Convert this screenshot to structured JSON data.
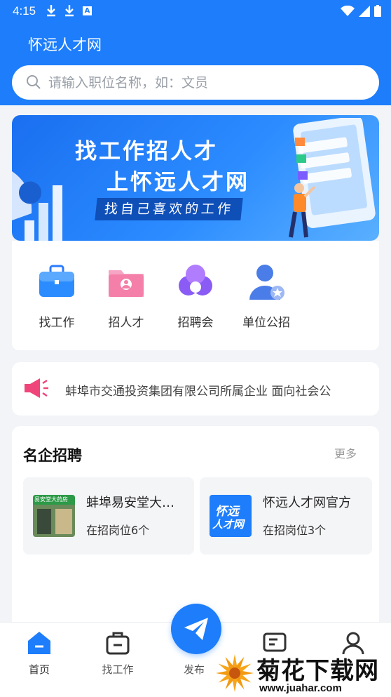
{
  "status_bar": {
    "time": "4:15",
    "keyboard_badge": "A"
  },
  "header": {
    "title": "怀远人才网"
  },
  "search": {
    "placeholder": "请输入职位名称，如：文员"
  },
  "banner": {
    "line1": "找工作招人才",
    "line2": "上怀远人才网",
    "tagline": "找自己喜欢的工作"
  },
  "quick_entries": [
    {
      "label": "找工作",
      "icon": "briefcase-icon"
    },
    {
      "label": "招人才",
      "icon": "user-folder-icon"
    },
    {
      "label": "招聘会",
      "icon": "group-meeting-icon"
    },
    {
      "label": "单位公招",
      "icon": "user-star-icon"
    }
  ],
  "notice": {
    "text": "蚌埠市交通投资集团有限公司所属企业 面向社会公",
    "icon": "megaphone-icon"
  },
  "famous": {
    "title": "名企招聘",
    "more": "更多",
    "companies": [
      {
        "name": "蚌埠易安堂大…",
        "count": "在招岗位6个",
        "logo_text": "易安堂大药房"
      },
      {
        "name": "怀远人才网官方",
        "count": "在招岗位3个",
        "logo_line1": "怀远",
        "logo_line2": "人才网"
      }
    ]
  },
  "bottom_nav": {
    "home": "首页",
    "jobs": "找工作",
    "publish": "发布"
  },
  "watermark": {
    "text": "菊花下载网",
    "url": "www.juahar.com"
  },
  "colors": {
    "primary": "#1d7dfb",
    "background": "#f2f4f7",
    "notice_icon": "#f0457a"
  }
}
